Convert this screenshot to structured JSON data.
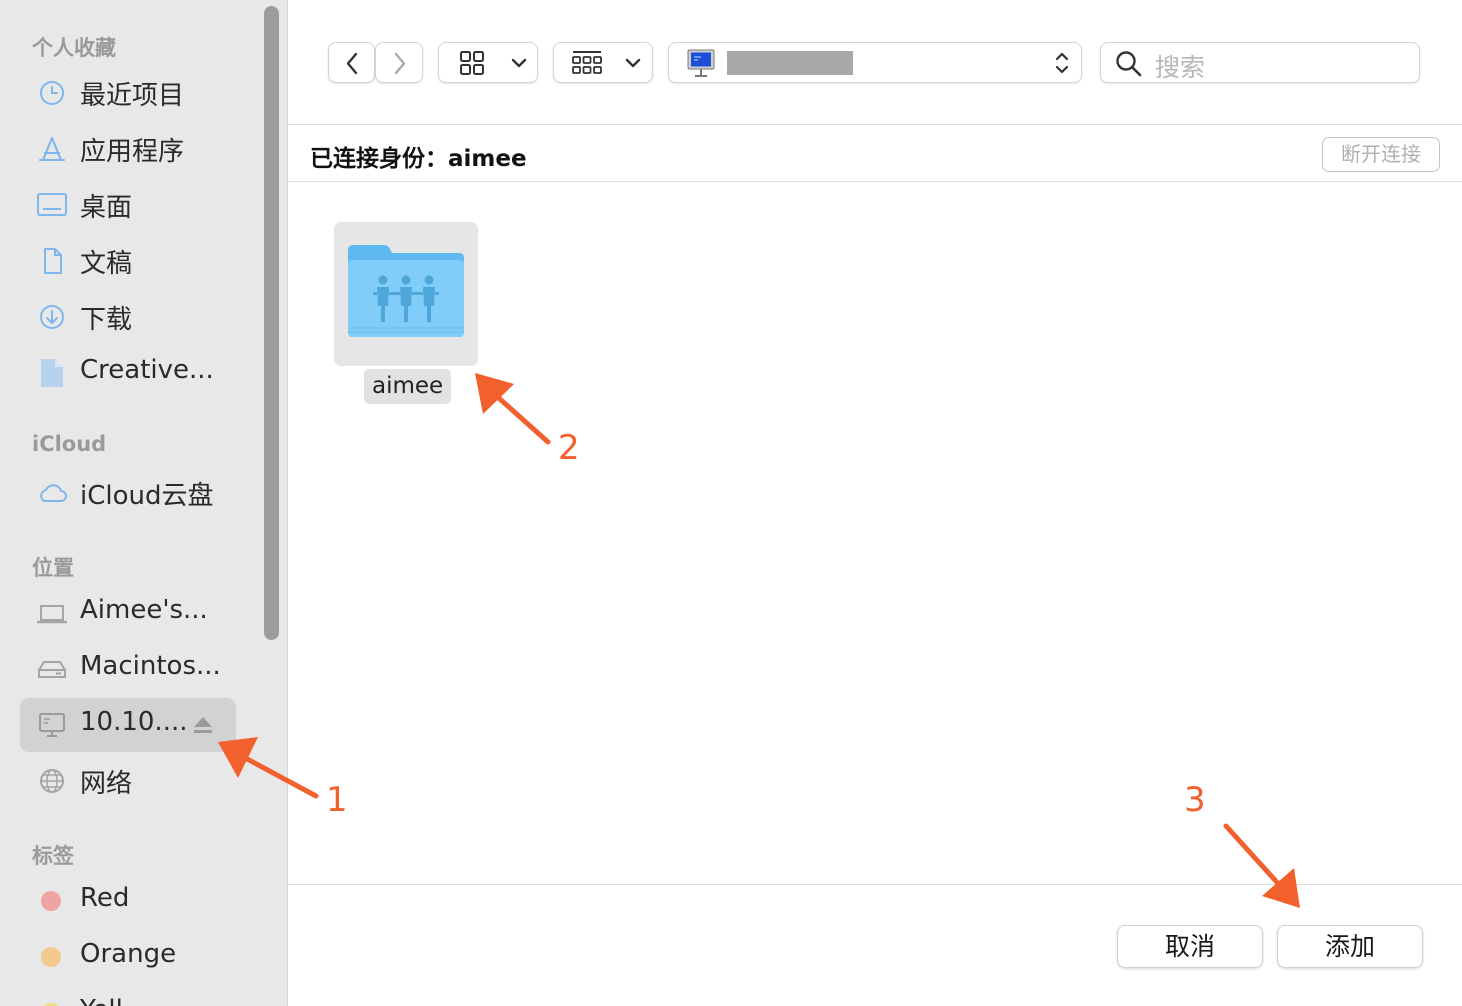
{
  "sidebar": {
    "sections": [
      {
        "heading": "个人收藏"
      },
      {
        "heading": "iCloud"
      },
      {
        "heading": "位置"
      },
      {
        "heading": "标签"
      }
    ],
    "favorites": [
      {
        "label": "最近项目",
        "icon": "clock-icon"
      },
      {
        "label": "应用程序",
        "icon": "applications-icon"
      },
      {
        "label": "桌面",
        "icon": "desktop-icon"
      },
      {
        "label": "文稿",
        "icon": "document-icon"
      },
      {
        "label": "下载",
        "icon": "download-icon"
      },
      {
        "label": "Creative...",
        "icon": "file-icon"
      }
    ],
    "icloud": [
      {
        "label": "iCloud云盘",
        "icon": "cloud-icon"
      }
    ],
    "locations": [
      {
        "label": "Aimee's...",
        "icon": "laptop-icon"
      },
      {
        "label": "Macintos...",
        "icon": "hard-drive-icon"
      },
      {
        "label": "10.10....",
        "icon": "server-icon",
        "selected": true,
        "ejectable": true
      },
      {
        "label": "网络",
        "icon": "network-globe-icon"
      }
    ],
    "tags": [
      {
        "label": "Red",
        "color": "#f0a3a0"
      },
      {
        "label": "Orange",
        "color": "#f3c98e"
      },
      {
        "label": "Yell",
        "color": "#f2de85"
      }
    ]
  },
  "toolbar": {
    "search_placeholder": "搜索",
    "path_icon": "server-icon"
  },
  "connection": {
    "label": "已连接身份：aimee",
    "disconnect_label": "断开连接"
  },
  "content": {
    "items": [
      {
        "name": "aimee",
        "icon": "shared-folder-icon",
        "selected": true
      }
    ]
  },
  "footer": {
    "cancel_label": "取消",
    "add_label": "添加"
  },
  "annotations": {
    "color": "#f2602e",
    "steps": [
      "1",
      "2",
      "3"
    ]
  }
}
